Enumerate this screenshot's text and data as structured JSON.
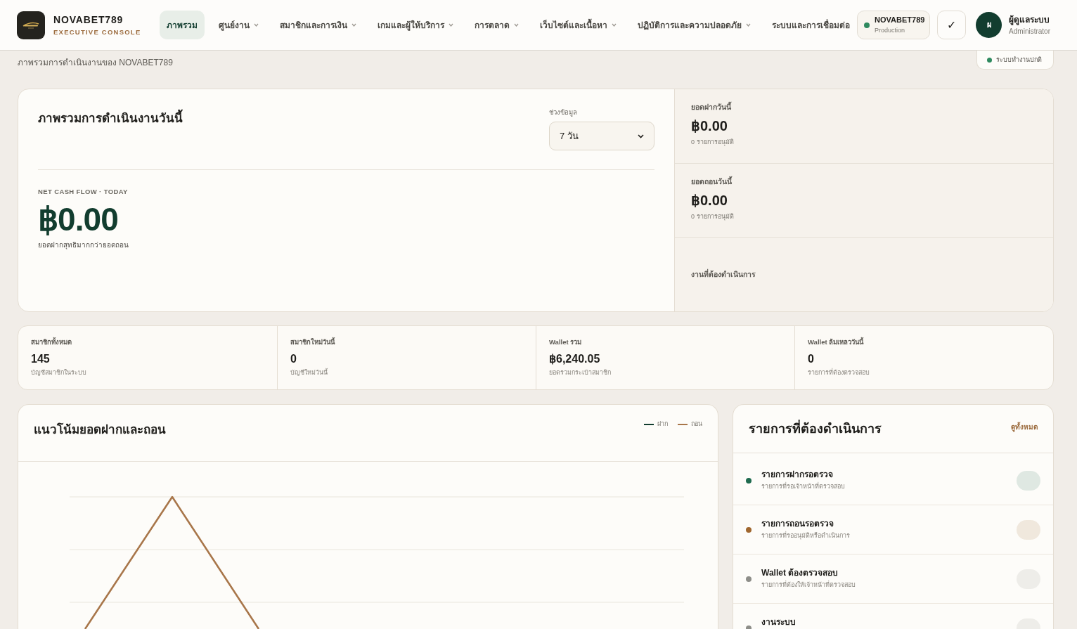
{
  "header": {
    "brand": {
      "name": "NOVABET789",
      "tagline": "EXECUTIVE CONSOLE"
    },
    "nav": [
      {
        "label": "ภาพรวม",
        "selected": true,
        "has_dropdown": false
      },
      {
        "label": "ศูนย์งาน",
        "selected": false,
        "has_dropdown": true
      },
      {
        "label": "สมาชิกและการเงิน",
        "selected": false,
        "has_dropdown": true
      },
      {
        "label": "เกมและผู้ให้บริการ",
        "selected": false,
        "has_dropdown": true
      },
      {
        "label": "การตลาด",
        "selected": false,
        "has_dropdown": true
      },
      {
        "label": "เว็บไซต์และเนื้อหา",
        "selected": false,
        "has_dropdown": true
      },
      {
        "label": "ปฏิบัติการและความปลอดภัย",
        "selected": false,
        "has_dropdown": true
      },
      {
        "label": "ระบบและการเชื่อมต่อ",
        "selected": false,
        "has_dropdown": false
      }
    ],
    "environment": {
      "name": "NOVABET789",
      "stage": "Production"
    },
    "check_button": {
      "label": "✓"
    },
    "user": {
      "initial": "ผ",
      "name": "ผู้ดูแลระบบ",
      "role": "Administrator"
    }
  },
  "page": {
    "subtitle": "ภาพรวมการดำเนินงานของ NOVABET789",
    "system_status": "ระบบทำงานปกติ"
  },
  "overview": {
    "title": "ภาพรวมการดำเนินงานวันนี้",
    "range": {
      "label": "ช่วงข้อมูล",
      "value": "7 วัน"
    },
    "net_cash_flow": {
      "label": "NET CASH FLOW · TODAY",
      "amount": "฿0.00",
      "note": "ยอดฝากสุทธิมากกว่ายอดถอน"
    },
    "side": [
      {
        "label": "ยอดฝากวันนี้",
        "amount": "฿0.00",
        "note": "0 รายการอนุมัติ"
      },
      {
        "label": "ยอดถอนวันนี้",
        "amount": "฿0.00",
        "note": "0 รายการอนุมัติ"
      },
      {
        "label": "งานที่ต้องดำเนินการ"
      }
    ]
  },
  "stats": [
    {
      "label": "สมาชิกทั้งหมด",
      "value": "145",
      "note": "บัญชีสมาชิกในระบบ"
    },
    {
      "label": "สมาชิกใหม่วันนี้",
      "value": "0",
      "note": "บัญชีใหม่วันนี้"
    },
    {
      "label": "Wallet รวม",
      "value": "฿6,240.05",
      "note": "ยอดรวมกระเป๋าสมาชิก"
    },
    {
      "label": "Wallet ล้มเหลววันนี้",
      "value": "0",
      "note": "รายการที่ต้องตรวจสอบ"
    }
  ],
  "trend": {
    "title": "แนวโน้มยอดฝากและถอน",
    "legend": [
      {
        "label": "ฝาก",
        "color": "#123d2f"
      },
      {
        "label": "ถอน",
        "color": "#a8764a"
      }
    ]
  },
  "tasks": {
    "title": "รายการที่ต้องดำเนินการ",
    "view_all": "ดูทั้งหมด",
    "items": [
      {
        "title": "รายการฝากรอตรวจ",
        "subtitle": "รายการที่รอเจ้าหน้าที่ตรวจสอบ",
        "color": "#1f6b4f"
      },
      {
        "title": "รายการถอนรอตรวจ",
        "subtitle": "รายการที่รออนุมัติหรือดำเนินการ",
        "color": "#a0672f"
      },
      {
        "title": "Wallet ต้องตรวจสอบ",
        "subtitle": "รายการที่ต้องให้เจ้าหน้าที่ตรวจสอบ",
        "color": "#8e8e89"
      },
      {
        "title": "งานระบบ",
        "color": "#8e8e89"
      }
    ]
  }
}
